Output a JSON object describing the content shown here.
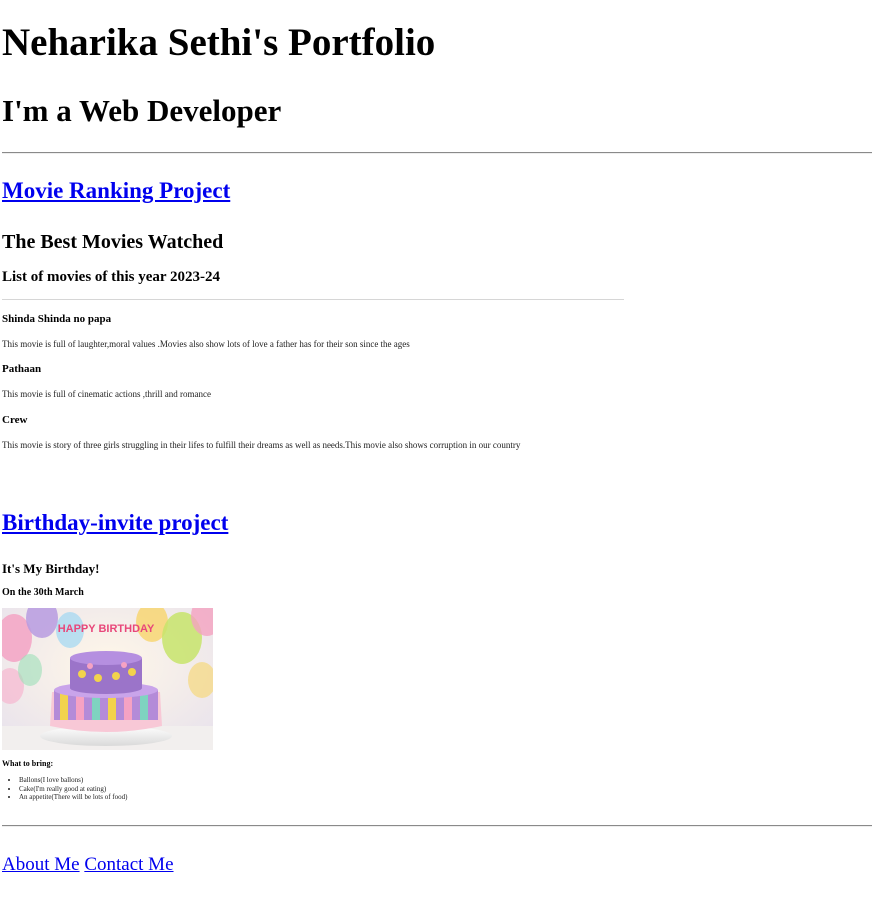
{
  "header": {
    "title": "Neharika Sethi's Portfolio",
    "subtitle": "I'm a Web Developer"
  },
  "projects": [
    {
      "link_label": "Movie Ranking Project",
      "heading": "The Best Movies Watched",
      "subheading": "List of movies of this year 2023-24",
      "movies": [
        {
          "title": "Shinda Shinda no papa",
          "description": "This movie is full of laughter,moral values .Movies also show lots of love a father has for their son since the ages"
        },
        {
          "title": "Pathaan",
          "description": "This movie is full of cinematic actions ,thrill and romance"
        },
        {
          "title": "Crew",
          "description": "This movie is story of three girls struggling in their lifes to fulfill their dreams as well as needs.This movie also shows corruption in our country"
        }
      ]
    },
    {
      "link_label": "Birthday-invite project",
      "heading": "It's My Birthday!",
      "date_line": "On the 30th March",
      "image_sign_text": "HAPPY BIRTHDAY",
      "bring_heading": "What to bring:",
      "bring_items": [
        "Ballons(I love ballons)",
        "Cake(I'm really good at eating)",
        "An appetite(There will be lots of food)"
      ]
    }
  ],
  "footer": {
    "about_label": "About Me",
    "contact_label": "Contact Me"
  },
  "colors": {
    "link": "#0000ee",
    "rule": "#8a8a8a"
  }
}
